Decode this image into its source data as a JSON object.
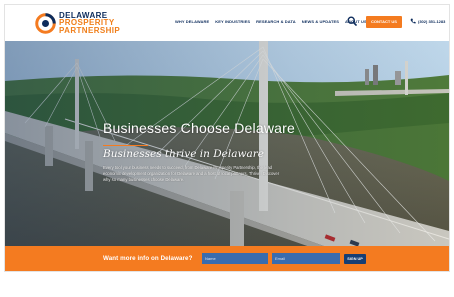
{
  "brand": {
    "line1": "DELAWARE",
    "line2": "PROSPERITY",
    "line3": "PARTNERSHIP",
    "color_navy": "#0d2c5c",
    "color_orange": "#f47b20"
  },
  "nav": {
    "items": [
      {
        "label": "WHY DELAWARE"
      },
      {
        "label": "KEY INDUSTRIES"
      },
      {
        "label": "RESEARCH & DATA"
      },
      {
        "label": "NEWS & UPDATES"
      },
      {
        "label": "ABOUT US"
      }
    ],
    "search_icon": "search-icon",
    "contact_label": "CONTACT US",
    "phone": "(302) 351-1283",
    "phone_icon": "phone-icon"
  },
  "hero": {
    "title": "Businesses Choose Delaware",
    "subtitle": "Businesses thrive in Delaware",
    "body": "Every tool your business needs to succeed, from Delaware Prosperity Partnership, the lead economic development organization for Delaware and a host of local partners. Thrive. Discover why so many businesses choose Delaware."
  },
  "signup": {
    "label": "Want more info on Delaware?",
    "name_placeholder": "Name",
    "email_placeholder": "Email",
    "button_label": "SIGN UP"
  }
}
